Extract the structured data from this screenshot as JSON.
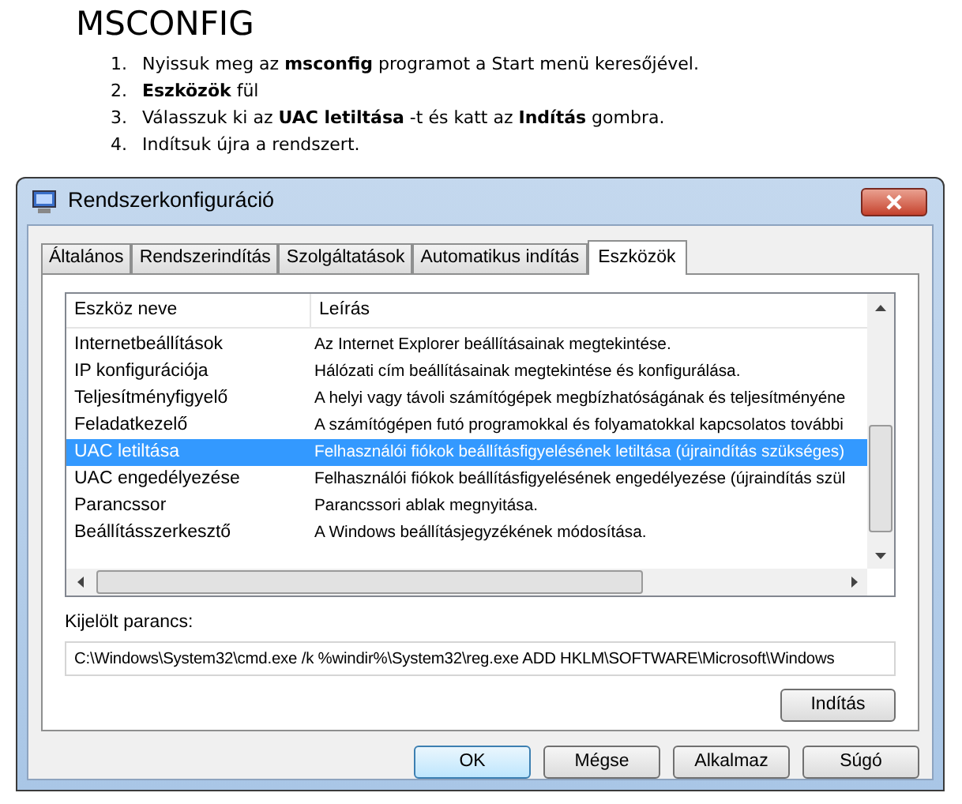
{
  "heading": "MSCONFIG",
  "steps": [
    {
      "number": "1.",
      "text": "Nyissuk meg az **msconfig** programot a Start menü keresőjével."
    },
    {
      "number": "2.",
      "text": "**Eszközök** fül"
    },
    {
      "number": "3.",
      "text": "Válasszuk ki az **UAC letiltása** -t és katt az **Indítás** gombra."
    },
    {
      "number": "4.",
      "text": "Indítsuk újra a rendszert."
    }
  ],
  "window": {
    "title": "Rendszerkonfiguráció"
  },
  "tabs": [
    {
      "label": "Általános",
      "selected": false
    },
    {
      "label": "Rendszerindítás",
      "selected": false
    },
    {
      "label": "Szolgáltatások",
      "selected": false
    },
    {
      "label": "Automatikus indítás",
      "selected": false
    },
    {
      "label": "Eszközök",
      "selected": true
    }
  ],
  "table": {
    "columns": [
      "Eszköz neve",
      "Leírás"
    ],
    "rows": [
      {
        "name": "Internetbeállítások",
        "description": "Az Internet Explorer beállításainak megtekintése.",
        "selected": false
      },
      {
        "name": "IP konfigurációja",
        "description": "Hálózati cím beállításainak megtekintése és konfigurálása.",
        "selected": false
      },
      {
        "name": "Teljesítményfigyelő",
        "description": "A helyi vagy távoli számítógépek megbízhatóságának és teljesítményéne",
        "selected": false
      },
      {
        "name": "Feladatkezelő",
        "description": "A számítógépen futó programokkal és folyamatokkal kapcsolatos további",
        "selected": false
      },
      {
        "name": "UAC letiltása",
        "description": "Felhasználói fiókok beállításfigyelésének letiltása (újraindítás szükséges)",
        "selected": true
      },
      {
        "name": "UAC engedélyezése",
        "description": "Felhasználói fiókok beállításfigyelésének engedélyezése (újraindítás szül",
        "selected": false
      },
      {
        "name": "Parancssor",
        "description": "Parancssori ablak megnyitása.",
        "selected": false
      },
      {
        "name": "Beállításszerkesztő",
        "description": "A Windows beállításjegyzékének módosítása.",
        "selected": false
      }
    ]
  },
  "command": {
    "label": "Kijelölt parancs:",
    "value": "C:\\Windows\\System32\\cmd.exe /k %windir%\\System32\\reg.exe ADD HKLM\\SOFTWARE\\Microsoft\\Windows"
  },
  "launch_button": "Indítás",
  "buttons": [
    {
      "label": "OK",
      "default": true
    },
    {
      "label": "Mégse",
      "default": false
    },
    {
      "label": "Alkalmaz",
      "default": false
    },
    {
      "label": "Súgó",
      "default": false
    }
  ]
}
